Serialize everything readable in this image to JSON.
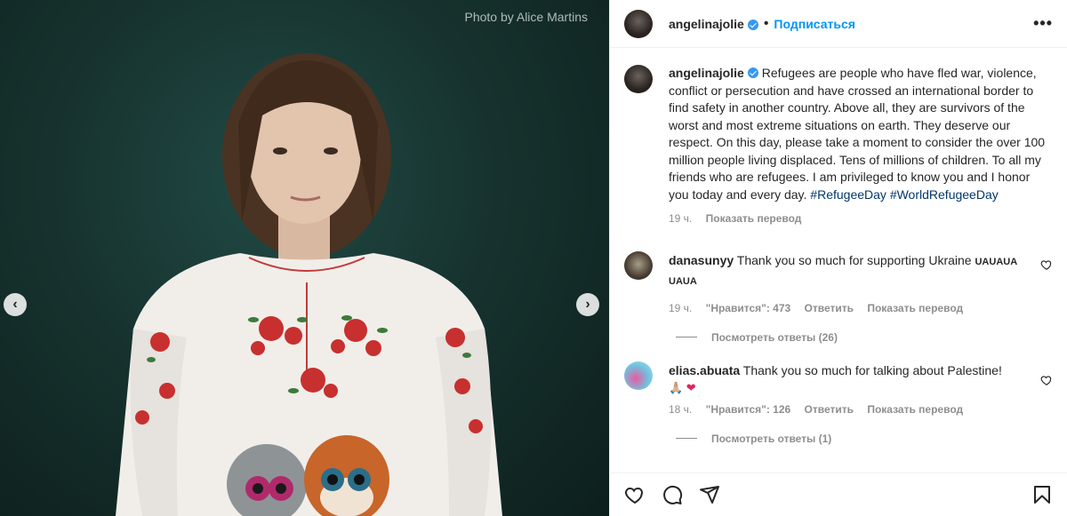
{
  "media": {
    "credit": "Photo by Alice Martins"
  },
  "header": {
    "username": "angelinajolie",
    "separator": "•",
    "follow_label": "Подписаться",
    "more_label": "•••"
  },
  "caption": {
    "username": "angelinajolie",
    "text": "Refugees are people who have fled war, violence, conflict or persecution and have crossed an international border to find safety in another country. Above all, they are survivors of the worst and most extreme situations on earth. They deserve our respect. On this day, please take a moment to consider the over 100 million people living displaced. Tens of millions of children. To all my friends who are refugees. I am privileged to know you and I honor you today and every day.",
    "hashtag1": "#RefugeeDay",
    "hashtag2": "#WorldRefugeeDay",
    "time": "19 ч.",
    "translate": "Показать перевод"
  },
  "comments": [
    {
      "username": "danasunyy",
      "text": "Thank you so much for supporting Ukraine",
      "flags": "UAUAUA UAUA",
      "time": "19 ч.",
      "likes": "\"Нравится\": 473",
      "reply": "Ответить",
      "translate": "Показать перевод",
      "view_replies": "Посмотреть ответы (26)"
    },
    {
      "username": "elias.abuata",
      "text": "Thank you so much for talking about Palestine!",
      "emoji": "🙏🏼 ❤",
      "time": "18 ч.",
      "likes": "\"Нравится\": 126",
      "reply": "Ответить",
      "translate": "Показать перевод",
      "view_replies": "Посмотреть ответы (1)"
    }
  ],
  "colors": {
    "link_blue": "#0095f6",
    "hashtag": "#00376b",
    "muted": "#8e8e8e",
    "heart_red": "#e0245e"
  },
  "icons": [
    "heart-icon",
    "comment-icon",
    "share-icon",
    "bookmark-icon",
    "more-icon",
    "chevron-left-icon",
    "chevron-right-icon",
    "verified-icon"
  ]
}
